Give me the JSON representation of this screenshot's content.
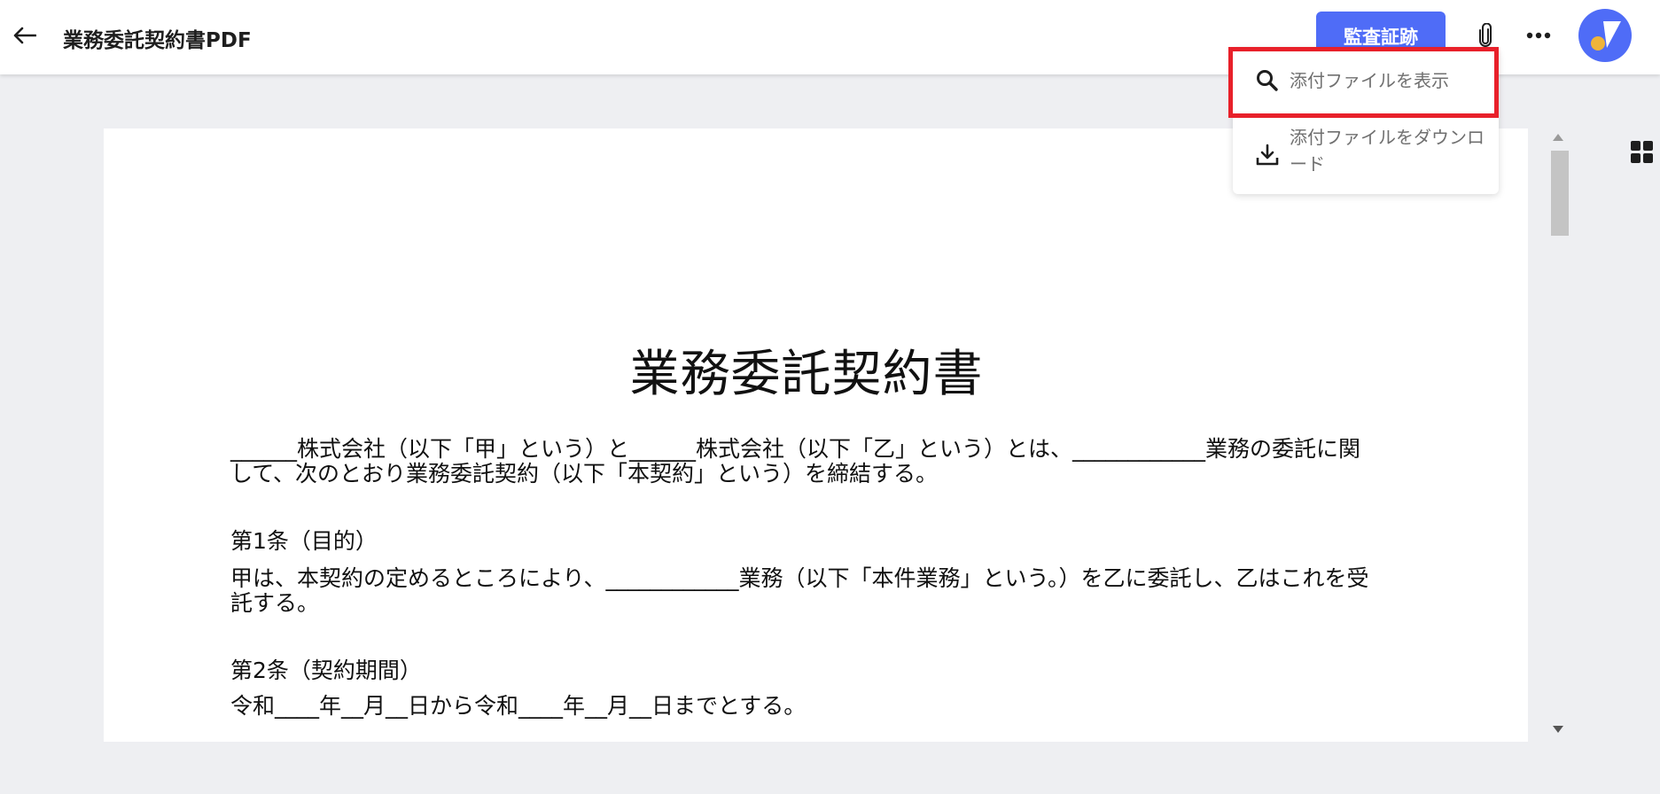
{
  "header": {
    "title": "業務委託契約書PDF",
    "audit_label": "監査証跡",
    "back_icon": "arrow-left-icon",
    "attach_icon": "paperclip-icon",
    "more_icon": "more-horizontal-icon"
  },
  "menu": {
    "items": [
      {
        "label": "添付ファイルを表示",
        "icon": "search-icon"
      },
      {
        "label": "添付ファイルをダウンロード",
        "icon": "download-icon"
      }
    ]
  },
  "document": {
    "title": "業務委託契約書",
    "intro": "______株式会社（以下「甲」という）と______株式会社（以下「乙」という）とは、____________業務の委託に関して、次のとおり業務委託契約（以下「本契約」という）を締結する。",
    "sections": [
      {
        "heading": "第1条（目的）",
        "body": "甲は、本契約の定めるところにより、____________業務（以下「本件業務」という。）を乙に委託し、乙はこれを受託する。"
      },
      {
        "heading": "第2条（契約期間）",
        "body": "令和____年__月__日から令和____年__月__日までとする。"
      }
    ]
  },
  "colors": {
    "accent": "#4f6cf7",
    "highlight": "#e8202a",
    "avatar_dot": "#f0b43a"
  }
}
